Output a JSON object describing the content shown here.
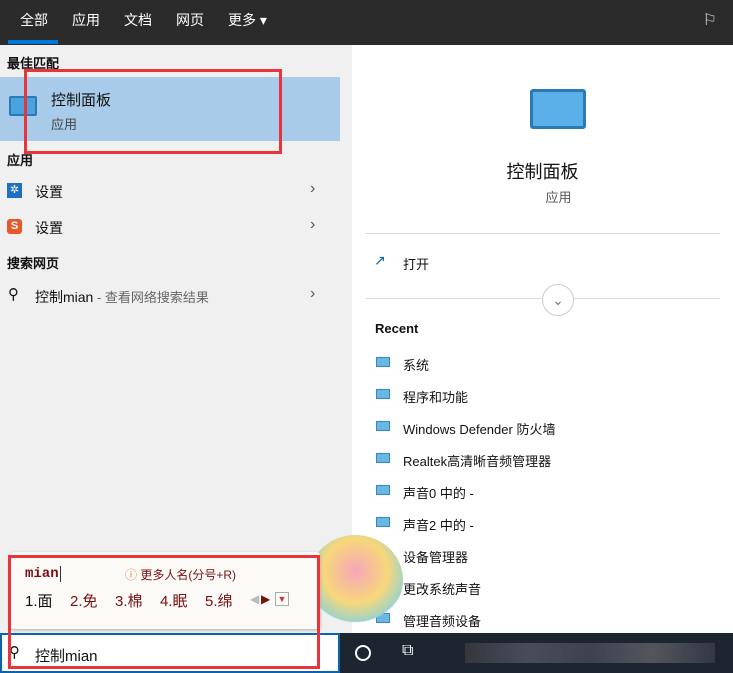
{
  "tabs": [
    "全部",
    "应用",
    "文档",
    "网页",
    "更多"
  ],
  "best_match": {
    "heading": "最佳匹配",
    "title": "控制面板",
    "subtitle": "应用"
  },
  "apps": {
    "heading": "应用",
    "items": [
      "设置",
      "设置"
    ]
  },
  "web": {
    "heading": "搜索网页",
    "query": "控制mian",
    "suffix": " - 查看网络搜索结果"
  },
  "detail": {
    "title": "控制面板",
    "subtitle": "应用",
    "open": "打开",
    "recent_heading": "Recent",
    "recent": [
      "系统",
      "程序和功能",
      "Windows Defender 防火墙",
      "Realtek高清晰音频管理器",
      "声音0 中的 -",
      "声音2 中的 -",
      "设备管理器",
      "更改系统声音",
      "管理音频设备"
    ]
  },
  "ime": {
    "composition": "mian",
    "hint": "更多人名(分号+R)",
    "candidates": [
      "1.面",
      "2.免",
      "3.棉",
      "4.眠",
      "5.绵"
    ]
  },
  "search": {
    "value": "控制mian"
  }
}
